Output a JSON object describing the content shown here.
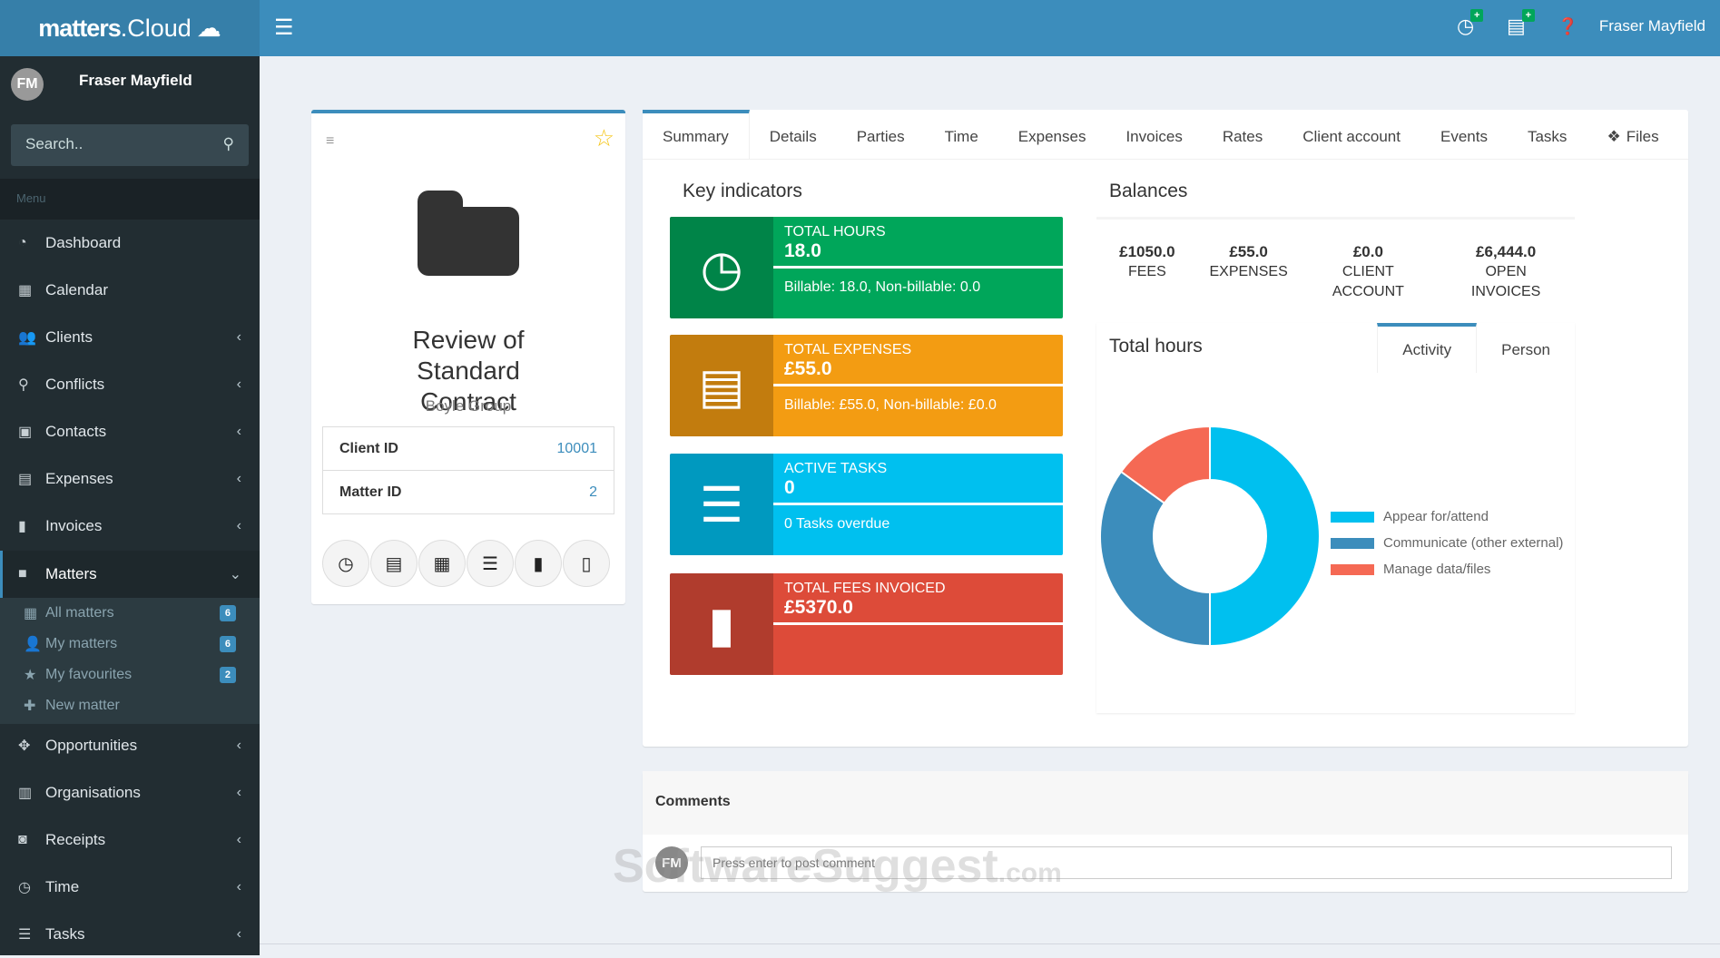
{
  "app": {
    "logo_main": "matters",
    "logo_suffix": ".Cloud",
    "user": "Fraser Mayfield",
    "initials": "FM"
  },
  "sidebar": {
    "search_placeholder": "Search..",
    "menu_label": "Menu",
    "items": [
      {
        "label": "Dashboard",
        "icon": "dashboard-icon"
      },
      {
        "label": "Calendar",
        "icon": "calendar-icon"
      },
      {
        "label": "Clients",
        "icon": "users-icon"
      },
      {
        "label": "Conflicts",
        "icon": "search-icon"
      },
      {
        "label": "Contacts",
        "icon": "address-card-icon"
      },
      {
        "label": "Expenses",
        "icon": "credit-card-icon"
      },
      {
        "label": "Invoices",
        "icon": "file-icon"
      },
      {
        "label": "Matters",
        "icon": "folder-icon"
      },
      {
        "label": "Opportunities",
        "icon": "crosshairs-icon"
      },
      {
        "label": "Organisations",
        "icon": "building-icon"
      },
      {
        "label": "Receipts",
        "icon": "money-icon"
      },
      {
        "label": "Time",
        "icon": "clock-icon"
      },
      {
        "label": "Tasks",
        "icon": "tasks-icon"
      }
    ],
    "submenu": [
      {
        "label": "All matters",
        "badge": "6"
      },
      {
        "label": "My matters",
        "badge": "6"
      },
      {
        "label": "My favourites",
        "badge": "2"
      },
      {
        "label": "New matter"
      }
    ]
  },
  "matter": {
    "title": "Review of Standard Contract",
    "client": "Boyle Group",
    "client_id_label": "Client ID",
    "client_id": "10001",
    "matter_id_label": "Matter ID",
    "matter_id": "2"
  },
  "tabs": [
    "Summary",
    "Details",
    "Parties",
    "Time",
    "Expenses",
    "Invoices",
    "Rates",
    "Client account",
    "Events",
    "Tasks",
    "Files"
  ],
  "key_indicators": {
    "title": "Key indicators",
    "boxes": [
      {
        "label": "TOTAL HOURS",
        "value": "18.0",
        "desc": "Billable: 18.0, Non-billable: 0.0",
        "color": "#00a65a"
      },
      {
        "label": "TOTAL EXPENSES",
        "value": "£55.0",
        "desc": "Billable: £55.0, Non-billable: £0.0",
        "color": "#f39c12"
      },
      {
        "label": "ACTIVE TASKS",
        "value": "0",
        "desc": "0 Tasks overdue",
        "color": "#00c0ef"
      },
      {
        "label": "TOTAL FEES INVOICED",
        "value": "£5370.0",
        "desc": "",
        "color": "#dd4b39"
      }
    ]
  },
  "balances": {
    "title": "Balances",
    "items": [
      {
        "value": "£1050.0",
        "label": "FEES"
      },
      {
        "value": "£55.0",
        "label": "EXPENSES"
      },
      {
        "value": "£0.0",
        "label": "CLIENT ACCOUNT"
      },
      {
        "value": "£6,444.0",
        "label": "OPEN INVOICES"
      }
    ]
  },
  "total_hours": {
    "title": "Total hours",
    "tabs": [
      "Activity",
      "Person"
    ]
  },
  "chart_data": {
    "type": "pie",
    "title": "Total hours",
    "donut": true,
    "legend_position": "right",
    "categories": [
      "Appear for/attend",
      "Communicate (other external)",
      "Manage data/files"
    ],
    "values": [
      50,
      35,
      15
    ],
    "unit": "percent (estimated)",
    "colors": [
      "#00c0ef",
      "#3c8dbc",
      "#f56954"
    ]
  },
  "comments": {
    "title": "Comments",
    "placeholder": "Press enter to post comment"
  },
  "watermark": "SoftwareSuggest.com"
}
